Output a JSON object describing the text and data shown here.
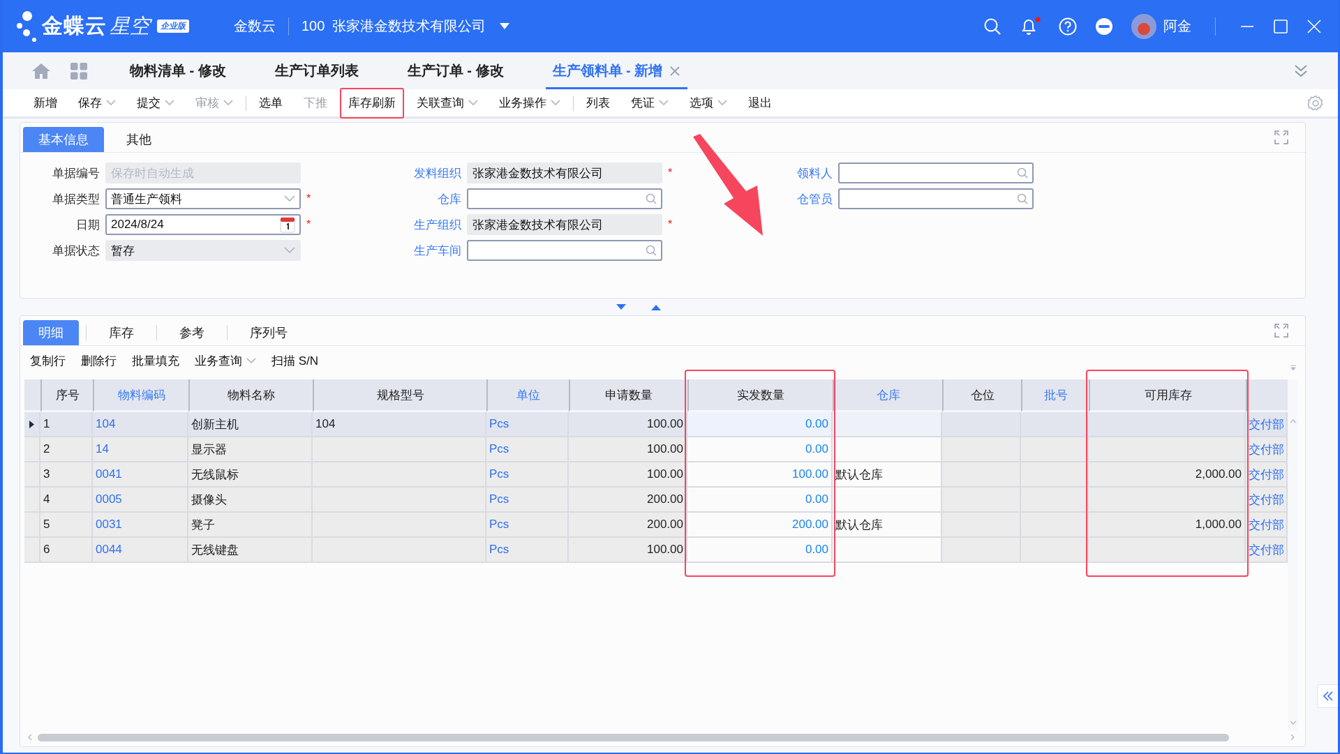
{
  "header": {
    "brand": "金蝶云",
    "brand_sub": "星空",
    "edition": "企业版",
    "tenant": "金数云",
    "account": "100  张家港金数技术有限公司",
    "user": "阿金",
    "has_notification": true
  },
  "tabs": [
    {
      "label": "物料清单 - 修改",
      "selected": false
    },
    {
      "label": "生产订单列表",
      "selected": false
    },
    {
      "label": "生产订单 - 修改",
      "selected": false
    },
    {
      "label": "生产领料单 - 新增",
      "selected": true
    }
  ],
  "toolbar_groups": [
    [
      {
        "label": "新增",
        "dropdown": false,
        "disabled": false,
        "highlighted": false
      },
      {
        "label": "保存",
        "dropdown": true,
        "disabled": false,
        "highlighted": false
      },
      {
        "label": "提交",
        "dropdown": true,
        "disabled": false,
        "highlighted": false
      },
      {
        "label": "审核",
        "dropdown": true,
        "disabled": true,
        "highlighted": false
      }
    ],
    [
      {
        "label": "选单",
        "dropdown": false,
        "disabled": false,
        "highlighted": false
      },
      {
        "label": "下推",
        "dropdown": false,
        "disabled": true,
        "highlighted": false
      },
      {
        "label": "库存刷新",
        "dropdown": false,
        "disabled": false,
        "highlighted": true
      },
      {
        "label": "关联查询",
        "dropdown": true,
        "disabled": false,
        "highlighted": false
      },
      {
        "label": "业务操作",
        "dropdown": true,
        "disabled": false,
        "highlighted": false
      }
    ],
    [
      {
        "label": "列表",
        "dropdown": false,
        "disabled": false,
        "highlighted": false
      },
      {
        "label": "凭证",
        "dropdown": true,
        "disabled": false,
        "highlighted": false
      },
      {
        "label": "选项",
        "dropdown": true,
        "disabled": false,
        "highlighted": false
      },
      {
        "label": "退出",
        "dropdown": false,
        "disabled": false,
        "highlighted": false
      }
    ]
  ],
  "form": {
    "tabs": [
      {
        "label": "基本信息",
        "selected": true
      },
      {
        "label": "其他",
        "selected": false
      }
    ],
    "columns": [
      [
        {
          "label": "单据编号",
          "kind": "readonly",
          "placeholder": "保存时自动生成",
          "link": false,
          "disabled": true
        },
        {
          "label": "单据类型",
          "kind": "select",
          "value": "普通生产领料",
          "marker": "*",
          "link": false,
          "disabled": false
        },
        {
          "label": "日期",
          "kind": "date",
          "value": "2024/8/24",
          "marker": "*",
          "link": false,
          "disabled": false
        },
        {
          "label": "单据状态",
          "kind": "select",
          "value": "暂存",
          "link": false,
          "disabled": true
        }
      ],
      [
        {
          "label": "发料组织",
          "kind": "readonly",
          "value": "张家港金数技术有限公司",
          "marker": "*",
          "link": true,
          "disabled": true
        },
        {
          "label": "仓库",
          "kind": "lookup",
          "link": true,
          "disabled": false
        },
        {
          "label": "生产组织",
          "kind": "readonly",
          "value": "张家港金数技术有限公司",
          "marker": "*",
          "link": true,
          "disabled": true
        },
        {
          "label": "生产车间",
          "kind": "lookup",
          "link": true,
          "disabled": false
        }
      ],
      [
        {
          "label": "领料人",
          "kind": "lookup",
          "link": true,
          "disabled": false
        },
        {
          "label": "仓管员",
          "kind": "lookup",
          "link": true,
          "disabled": false
        }
      ]
    ]
  },
  "detail": {
    "tabs": [
      {
        "label": "明细",
        "selected": true
      },
      {
        "label": "库存",
        "selected": false
      },
      {
        "label": "参考",
        "selected": false
      },
      {
        "label": "序列号",
        "selected": false
      }
    ],
    "actions": [
      {
        "label": "复制行",
        "dropdown": false
      },
      {
        "label": "删除行",
        "dropdown": false
      },
      {
        "label": "批量填充",
        "dropdown": false
      },
      {
        "label": "业务查询",
        "dropdown": true
      },
      {
        "label": "扫描 S/N",
        "dropdown": false
      }
    ],
    "table": {
      "columns": [
        {
          "label": "序号",
          "kind": "text",
          "header_link": false,
          "annotated": false
        },
        {
          "label": "物料编码",
          "kind": "link",
          "header_link": true,
          "annotated": false
        },
        {
          "label": "物料名称",
          "kind": "text",
          "header_link": false,
          "annotated": false
        },
        {
          "label": "规格型号",
          "kind": "text",
          "header_link": false,
          "annotated": false
        },
        {
          "label": "单位",
          "kind": "link",
          "header_link": true,
          "annotated": false
        },
        {
          "label": "申请数量",
          "kind": "number",
          "header_link": false,
          "annotated": false
        },
        {
          "label": "实发数量",
          "kind": "entry",
          "header_link": false,
          "annotated": true
        },
        {
          "label": "仓库",
          "kind": "entry_text",
          "header_link": true,
          "annotated": false
        },
        {
          "label": "仓位",
          "kind": "text",
          "header_link": false,
          "annotated": false
        },
        {
          "label": "批号",
          "kind": "text",
          "header_link": true,
          "annotated": false
        },
        {
          "label": "可用库存",
          "kind": "number",
          "header_link": false,
          "annotated": true
        },
        {
          "kind": "link"
        }
      ],
      "rows": [
        {
          "selected": true,
          "cells": [
            "1",
            "104",
            "创新主机",
            "104",
            "Pcs",
            "100.00",
            "0.00",
            "",
            "",
            "",
            "",
            "交付部"
          ]
        },
        {
          "selected": false,
          "cells": [
            "2",
            "14",
            "显示器",
            "",
            "Pcs",
            "100.00",
            "0.00",
            "",
            "",
            "",
            "",
            "交付部"
          ]
        },
        {
          "selected": false,
          "cells": [
            "3",
            "0041",
            "无线鼠标",
            "",
            "Pcs",
            "100.00",
            "100.00",
            "默认仓库",
            "",
            "",
            "2,000.00",
            "交付部"
          ]
        },
        {
          "selected": false,
          "cells": [
            "4",
            "0005",
            "摄像头",
            "",
            "Pcs",
            "200.00",
            "0.00",
            "",
            "",
            "",
            "",
            "交付部"
          ]
        },
        {
          "selected": false,
          "cells": [
            "5",
            "0031",
            "凳子",
            "",
            "Pcs",
            "200.00",
            "200.00",
            "默认仓库",
            "",
            "",
            "1,000.00",
            "交付部"
          ]
        },
        {
          "selected": false,
          "cells": [
            "6",
            "0044",
            "无线键盘",
            "",
            "Pcs",
            "100.00",
            "0.00",
            "",
            "",
            "",
            "",
            "交付部"
          ]
        }
      ]
    }
  }
}
